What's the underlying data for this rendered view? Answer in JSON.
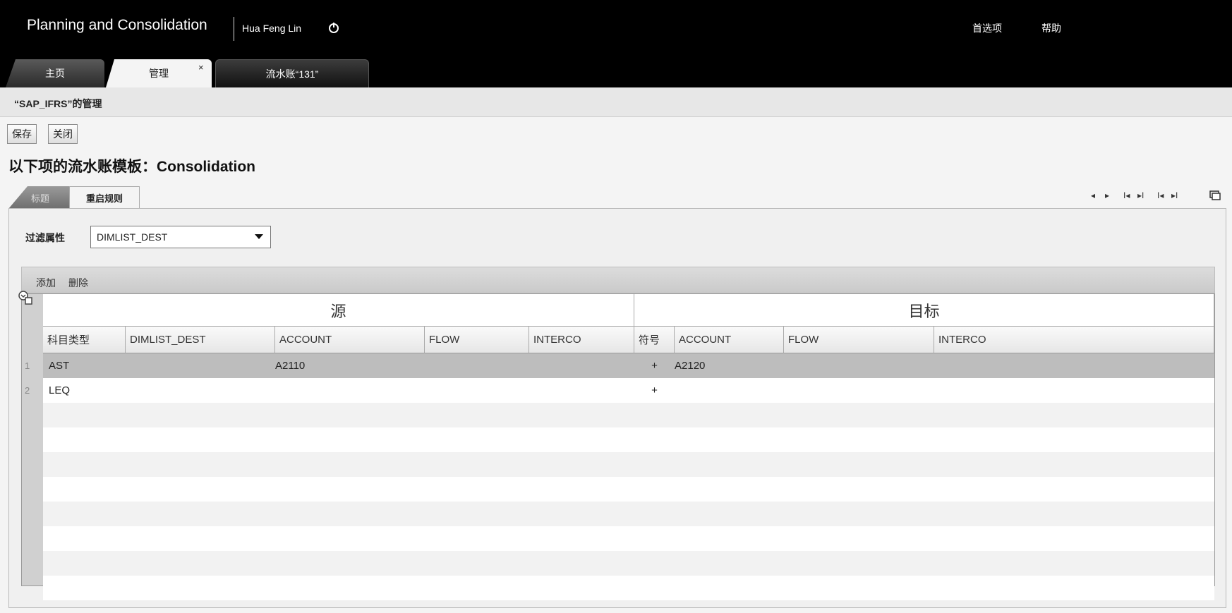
{
  "app": {
    "title": "Planning and Consolidation",
    "user": "Hua Feng Lin",
    "links": {
      "preferences": "首选项",
      "help": "帮助"
    }
  },
  "tabs": [
    {
      "label": "主页"
    },
    {
      "label": "管理",
      "close": "×"
    },
    {
      "label": "流水账“131”"
    }
  ],
  "subheader": {
    "title": "“SAP_IFRS”的管理"
  },
  "toolbar": {
    "save_label": "保存",
    "close_label": "关闭"
  },
  "page": {
    "heading": "以下项的流水账模板：Consolidation"
  },
  "subtabs": [
    {
      "label": "标题"
    },
    {
      "label": "重启规则"
    }
  ],
  "pager": {
    "prev": "◂",
    "next": "▸",
    "first": "I◂",
    "last": "▸I",
    "first2": "I◂",
    "last2": "▸I"
  },
  "filter": {
    "label": "过滤属性",
    "value": "DIMLIST_DEST"
  },
  "grid_toolbar": {
    "add": "添加",
    "delete": "删除"
  },
  "grid": {
    "groups": {
      "source": "源",
      "target": "目标"
    },
    "columns": [
      "科目类型",
      "DIMLIST_DEST",
      "ACCOUNT",
      "FLOW",
      "INTERCO",
      "符号",
      "ACCOUNT",
      "FLOW",
      "INTERCO"
    ],
    "rows": [
      {
        "num": "1",
        "cells": [
          "AST",
          "",
          "A2110",
          "",
          "",
          "+",
          "A2120",
          "",
          ""
        ]
      },
      {
        "num": "2",
        "cells": [
          "LEQ",
          "",
          "",
          "",
          "",
          "+",
          "",
          "",
          ""
        ]
      }
    ]
  },
  "colors": {
    "topbar": "#000000",
    "selected_row": "#bdbdbd",
    "panel": "#f0f0f0"
  }
}
